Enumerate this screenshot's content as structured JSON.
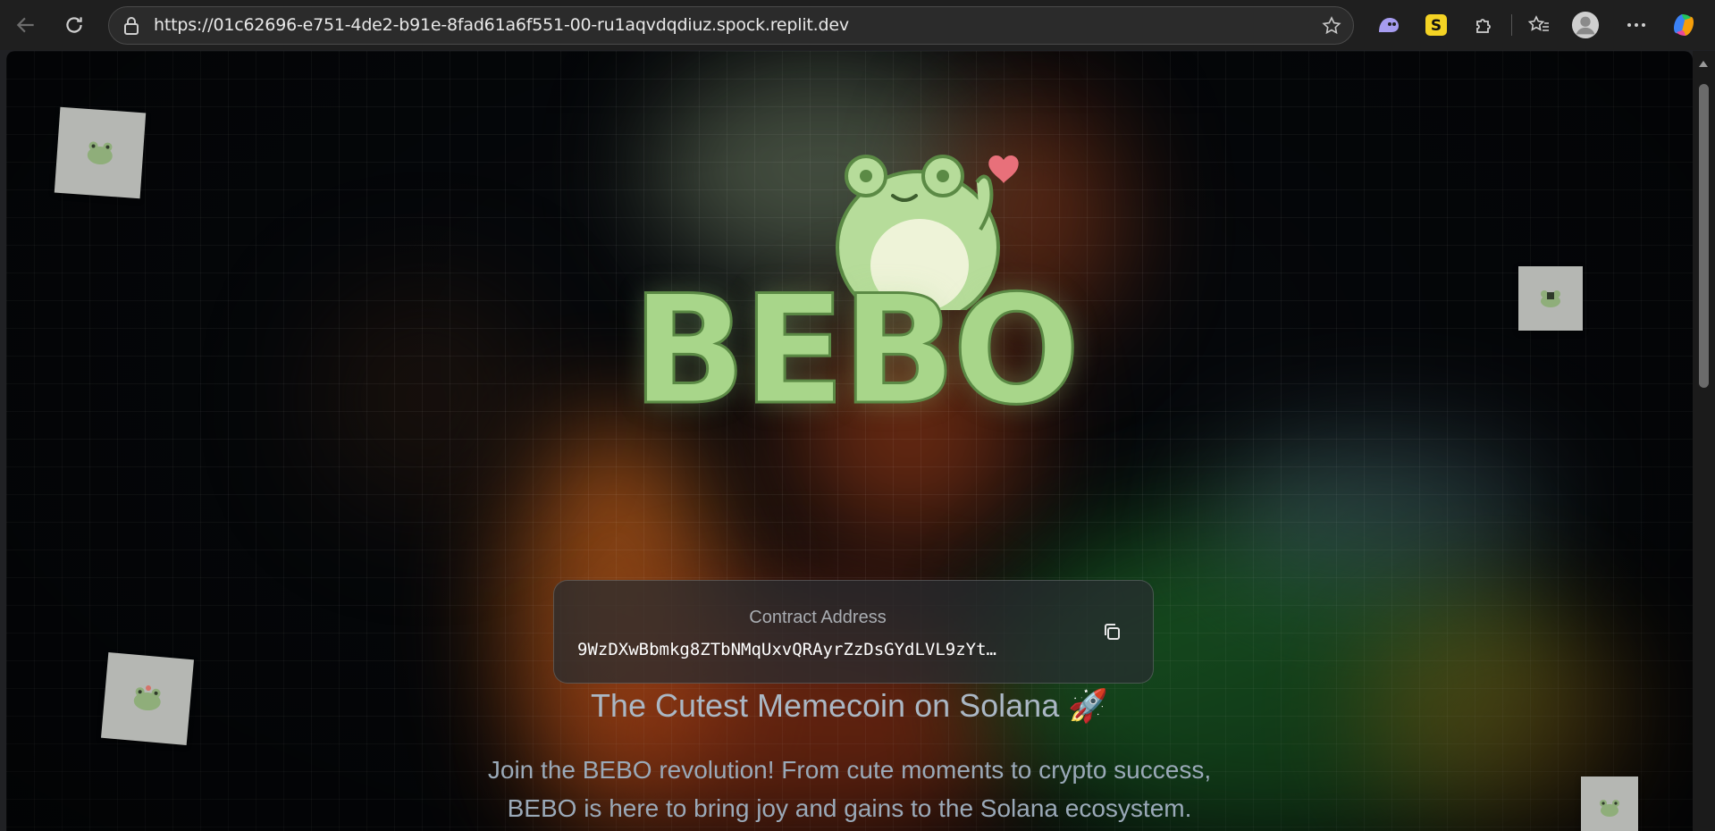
{
  "browser": {
    "url": "https://01c62696-e751-4de2-b91e-8fad61a6f551-00-ru1aqvdqdiuz.spock.replit.dev",
    "icons": [
      "back-icon",
      "refresh-icon",
      "lock-icon",
      "star-icon",
      "ghost-extension-icon",
      "s-extension-icon",
      "puzzle-icon",
      "favorites-icon",
      "profile-icon",
      "more-icon",
      "copilot-icon"
    ]
  },
  "hero": {
    "logo_text": "BEBO",
    "contract_label": "Contract Address",
    "contract_address": "9WzDXwBbmkg8ZTbNMqUxvQRAyrZzDsGYdLVL9zYt…",
    "tagline": "The Cutest Memecoin on Solana 🚀",
    "description_line1": "Join the BEBO revolution! From cute moments to crypto success,",
    "description_line2": "BEBO is here to bring joy and gains to the Solana ecosystem."
  },
  "colors": {
    "accent_green": "#a8d68a",
    "heart": "#e8707a",
    "page_bg": "#05070a"
  }
}
